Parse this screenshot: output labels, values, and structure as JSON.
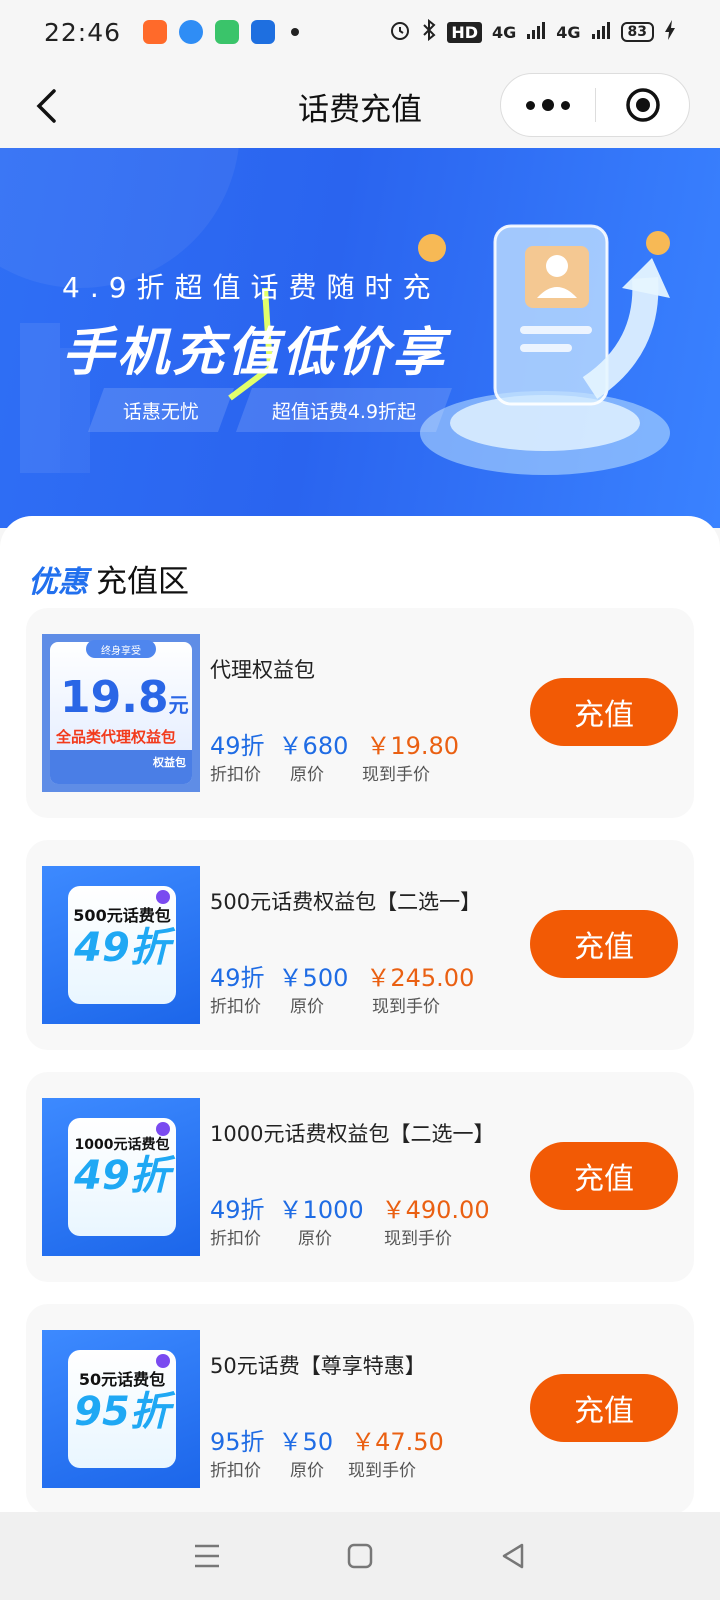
{
  "status_bar": {
    "time": "22:46",
    "network_1": "4G",
    "network_2": "4G",
    "hd_label": "HD",
    "battery": "83"
  },
  "nav": {
    "title": "话费充值"
  },
  "banner": {
    "subtitle": "4.9折超值话费随时充",
    "headline": "手机充值低价享",
    "tag_left": "话惠无忧",
    "tag_right": "超值话费4.9折起"
  },
  "section": {
    "accent": "优惠",
    "title": "充值区"
  },
  "labels": {
    "discount": "折扣价",
    "original": "原价",
    "final": "现到手价",
    "button": "充值"
  },
  "products": [
    {
      "name": "代理权益包",
      "discount": "49折",
      "original_price": "￥680",
      "final_price": "￥19.80",
      "thumb": {
        "top_label": "终身享受",
        "price": "19.8",
        "unit": "元",
        "desc": "全品类代理权益包",
        "foot_label": "权益包"
      }
    },
    {
      "name": "500元话费权益包【二选一】",
      "discount": "49折",
      "original_price": "￥500",
      "final_price": "￥245.00",
      "thumb": {
        "title": "500元话费包",
        "discount": "49折"
      }
    },
    {
      "name": "1000元话费权益包【二选一】",
      "discount": "49折",
      "original_price": "￥1000",
      "final_price": "￥490.00",
      "thumb": {
        "title": "1000元话费包",
        "discount": "49折"
      }
    },
    {
      "name": "50元话费【尊享特惠】",
      "discount": "95折",
      "original_price": "￥50",
      "final_price": "￥47.50",
      "thumb": {
        "title": "50元话费包",
        "discount": "95折"
      }
    }
  ]
}
